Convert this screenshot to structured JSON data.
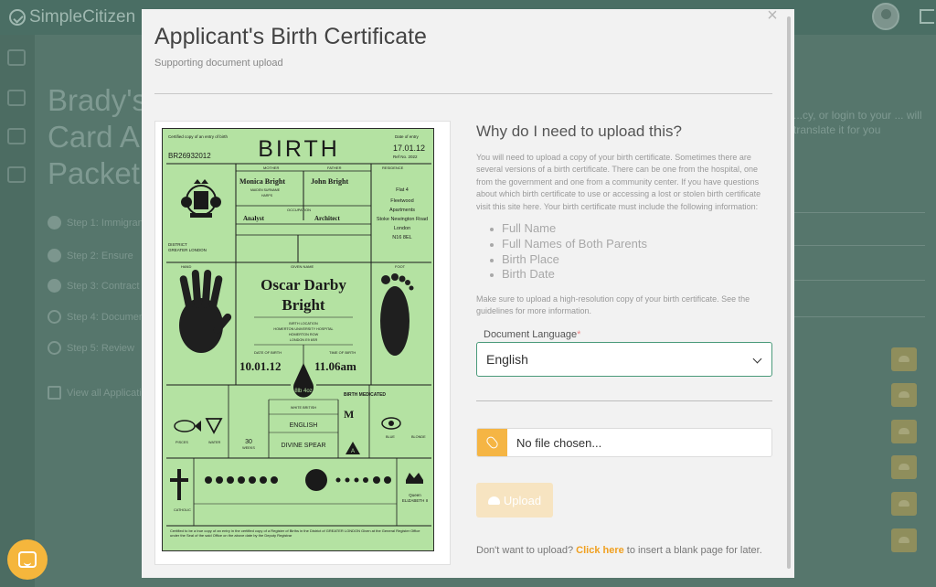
{
  "app": {
    "brand": "SimpleCitizen",
    "page_title": "Brady's Card Application Packet",
    "title_lines": [
      "Brady's",
      "Card A",
      "Packet"
    ],
    "steps": [
      "Step 1: Immigrant",
      "Step 2: Ensure",
      "Step 3: Contract",
      "Step 4: Document",
      "Step 5: Review"
    ],
    "view_all": "View all Applications",
    "right_text": "...cy, or login to your ... will translate it for you"
  },
  "modal": {
    "title": "Applicant's Birth Certificate",
    "subtitle": "Supporting document upload",
    "why_heading": "Why do I need to upload this?",
    "why_body": "You will need to upload a copy of your birth certificate. Sometimes there are several versions of a birth certificate. There can be one from the hospital, one from the government and one from a community center. If you have questions about which birth certificate to use or accessing a lost or stolen birth certificate visit this site here. Your birth certificate must include the following information:",
    "requirements": [
      "Full Name",
      "Full Names of Both Parents",
      "Birth Place",
      "Birth Date"
    ],
    "note": "Make sure to upload a high-resolution copy of your birth certificate. See the guidelines for more information.",
    "language_label": "Document Language",
    "language_required_mark": "*",
    "language_value": "English",
    "file_text": "No file chosen...",
    "upload_label": "Upload",
    "footer_prefix": "Don't want to upload?",
    "footer_link": "Click here",
    "footer_suffix": "to insert a blank page for later.",
    "close_glyph": "×"
  },
  "certificate": {
    "heading": "BIRTH",
    "cert_copy": "Certified copy of an entry of birth",
    "date_label": "Date of entry",
    "date_of_entry": "17.01.12",
    "ref": "Ref No. 2022",
    "number": "BR26932012",
    "mother": "Monica Bright",
    "mother_label": "MOTHER",
    "maiden": "MAIDEN SURNAME",
    "maiden_value": "HARPS",
    "father": "John Bright",
    "father_label": "FATHER",
    "mother_occupation": "Analyst",
    "father_occupation": "Architect",
    "occupation_label": "OCCUPATION",
    "residence_label": "RESIDENCE",
    "residence": [
      "Flat 4",
      "Fleetwood",
      "Apartments",
      "Stoke Newington Road",
      "London",
      "N16 8EL"
    ],
    "district": "DISTRICT",
    "district_value": "GREATER LONDON",
    "hand_label": "HAND",
    "foot_label": "FOOT",
    "given_name_label": "GIVEN NAME",
    "name_line1": "Oscar Darby",
    "name_line2": "Bright",
    "birth_location_label": "BIRTH LOCATION",
    "birth_location": [
      "HOMERTON UNIVERSITY HOSPITAL",
      "HOMERTON ROW",
      "LONDON E9 6SR"
    ],
    "date_label_birth": "DATE OF BIRTH",
    "date_of_birth": "10.01.12",
    "time_label": "TIME OF BIRTH",
    "time_of_birth": "11.06am",
    "weight": "8lb 4oz",
    "birth_medicated": "BIRTH MEDICATED",
    "ethnicity": "WHITE BRITISH",
    "language": "ENGLISH",
    "surname_origin": "DIVINE SPEAR",
    "birth_order": "30",
    "weeks": "WEEKS",
    "zodiac": "PISCES",
    "element": "WATER",
    "blood": "A",
    "eye": "BLUE",
    "hair": "BLONDE",
    "religion": "CATHOLIC",
    "monarch_label": "Queen",
    "monarch": "ELIZABETH II",
    "certified_text": "Certified to be a true copy of an entry in the certified copy of a Register of Births in the District of GREATER LONDON Given at the General Register Office under the Seal of the said Office on the above date by the Deputy Registrar"
  }
}
